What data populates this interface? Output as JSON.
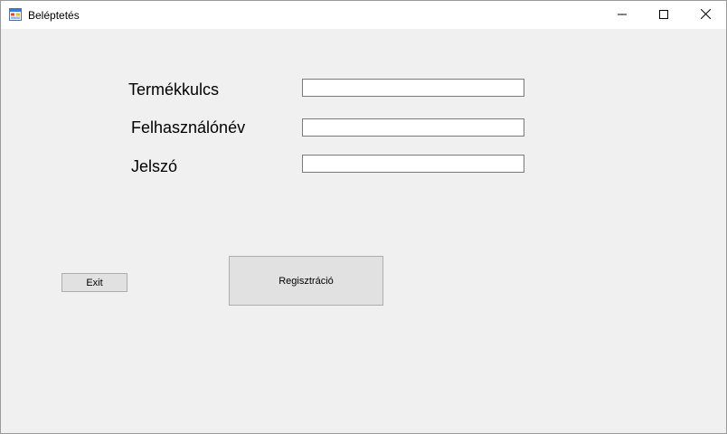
{
  "window": {
    "title": "Beléptetés"
  },
  "form": {
    "product_key_label": "Termékkulcs",
    "product_key_value": "",
    "username_label": "Felhasználónév",
    "username_value": "",
    "password_label": "Jelszó",
    "password_value": ""
  },
  "buttons": {
    "exit_label": "Exit",
    "register_label": "Regisztráció"
  },
  "icons": {
    "app": "app-window-icon",
    "minimize": "minimize-icon",
    "maximize": "maximize-icon",
    "close": "close-icon"
  }
}
